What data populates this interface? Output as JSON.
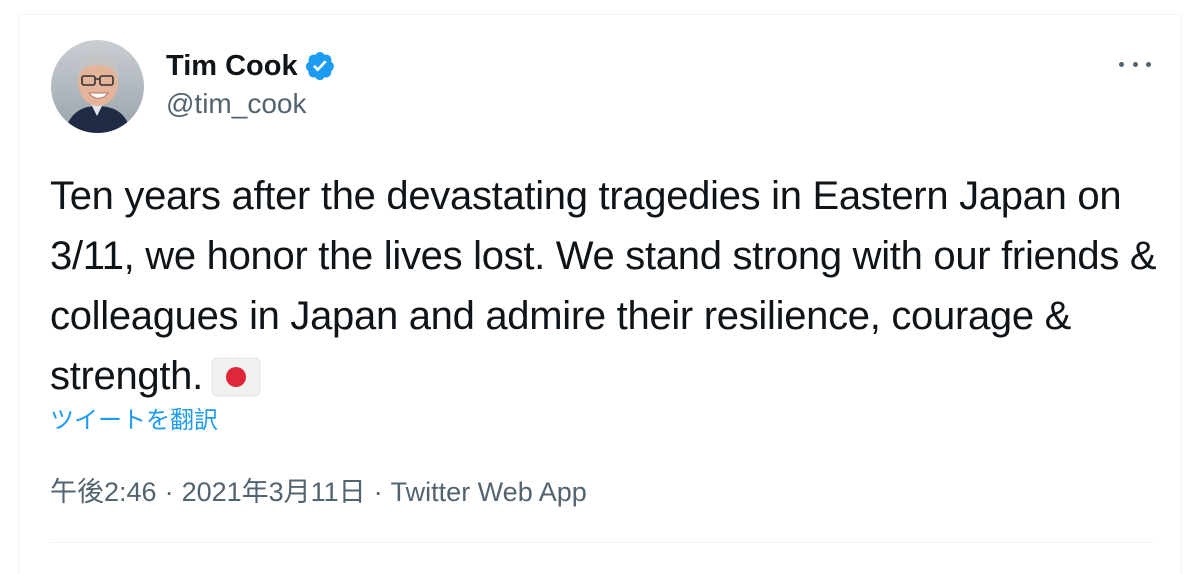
{
  "author": {
    "name": "Tim Cook",
    "handle": "@tim_cook",
    "verified": true
  },
  "tweet": {
    "text": "Ten years after the devastating tragedies in Eastern Japan on 3/11, we honor the lives lost. We stand strong with our friends & colleagues in Japan and admire their resilience, courage & strength.",
    "emoji": "japan-flag-emoji"
  },
  "translate_label": "ツイートを翻訳",
  "meta": {
    "time": "午後2:46",
    "separator": "·",
    "date": "2021年3月11日",
    "source": "Twitter Web App"
  },
  "icons": {
    "verified": "verified-badge-icon",
    "more": "more-options-icon"
  },
  "colors": {
    "verified": "#1d9bf0",
    "link": "#1d9bf0",
    "text": "#0f1419",
    "secondary": "#536471",
    "flag_red": "#e0263b"
  }
}
